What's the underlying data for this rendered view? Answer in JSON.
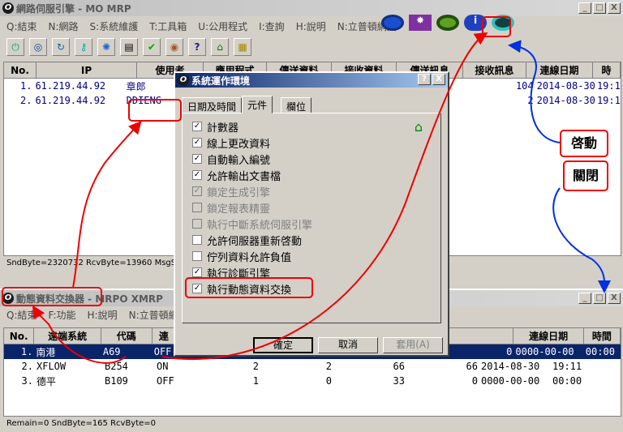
{
  "main_window": {
    "title": "網路伺服引擎 - MO MRP",
    "logo": "O",
    "btn_min": "_",
    "btn_max": "□",
    "btn_close": "X",
    "menu": [
      "Q:結束",
      "N:網路",
      "S:系統維護",
      "T:工具箱",
      "U:公用程式",
      "I:查詢",
      "H:說明",
      "N:立普頓網頁"
    ],
    "columns": [
      "No.",
      "IP",
      "使用者",
      "應用程式",
      "傳送資料",
      "接收資料",
      "傳送訊息",
      "接收訊息",
      "連線日期",
      "時"
    ],
    "rows": [
      {
        "no": "1.",
        "ip": "61.219.44.92",
        "user": "章郎",
        "recv_msg": "104",
        "date": "2014-08-30",
        "time": "19:1"
      },
      {
        "no": "2.",
        "ip": "61.219.44.92",
        "user": "DDIENG",
        "recv_msg": "2",
        "date": "2014-08-30",
        "time": "19:1"
      }
    ],
    "status": "SndByte=2320732 RcvByte=13960 MsgSen"
  },
  "sub_window": {
    "title": "動態資料交換器 - MRPO XMRP",
    "logo": "O",
    "btn_min": "_",
    "btn_max": "□",
    "btn_close": "X",
    "menu": [
      "Q:結束",
      "F:功能",
      "H:說明",
      "N:立普頓網頁"
    ],
    "columns": [
      "No.",
      "遠端系統",
      "代碼",
      "連"
    ],
    "right_columns": [
      "連線日期",
      "時間"
    ],
    "rows": [
      {
        "no": "1.",
        "system": "南港",
        "code": "A69",
        "state": "OFF",
        "c1": "",
        "c2": "",
        "c3": "",
        "c4": "0",
        "date": "0000-00-00",
        "time": "00:00"
      },
      {
        "no": "2.",
        "system": "XFLOW",
        "code": "B254",
        "state": "ON",
        "c1": "2",
        "c2": "2",
        "c3": "66",
        "c4": "66",
        "date": "2014-08-30",
        "time": "19:11"
      },
      {
        "no": "3.",
        "system": "德平",
        "code": "B109",
        "state": "OFF",
        "c1": "1",
        "c2": "0",
        "c3": "33",
        "c4": "0",
        "date": "0000-00-00",
        "time": "00:00"
      }
    ],
    "status": "Remain=0 SndByte=165 RcvByte=0"
  },
  "dialog": {
    "title": "系統運作環境",
    "help": "?",
    "close": "X",
    "tabs": [
      "日期及時間",
      "元件",
      "欄位"
    ],
    "options": [
      {
        "label": "計數器",
        "checked": "✓",
        "disabled": false
      },
      {
        "label": "線上更改資料",
        "checked": "✓",
        "disabled": false
      },
      {
        "label": "自動輸入編號",
        "checked": "✓",
        "disabled": false
      },
      {
        "label": "允許輸出文書檔",
        "checked": "✓",
        "disabled": false
      },
      {
        "label": "鎖定生成引擎",
        "checked": "✓",
        "disabled": true
      },
      {
        "label": "鎖定報表精靈",
        "checked": "",
        "disabled": true
      },
      {
        "label": "執行中斷系統伺服引擎",
        "checked": "",
        "disabled": true
      },
      {
        "label": "允許伺服器重新啓動",
        "checked": "",
        "disabled": false
      },
      {
        "label": "佇列資料允許負值",
        "checked": "",
        "disabled": false
      },
      {
        "label": "執行診斷引擎",
        "checked": "✓",
        "disabled": false
      },
      {
        "label": "執行動態資料交換",
        "checked": "✓",
        "disabled": false
      }
    ],
    "ok": "確定",
    "cancel": "取消",
    "apply": "套用(A)"
  },
  "annotation": {
    "start": "啓動",
    "close": "關閉"
  },
  "colors": {
    "accent": "#e00000",
    "selection": "#0a246a",
    "arrow_blue": "#0030e0"
  }
}
